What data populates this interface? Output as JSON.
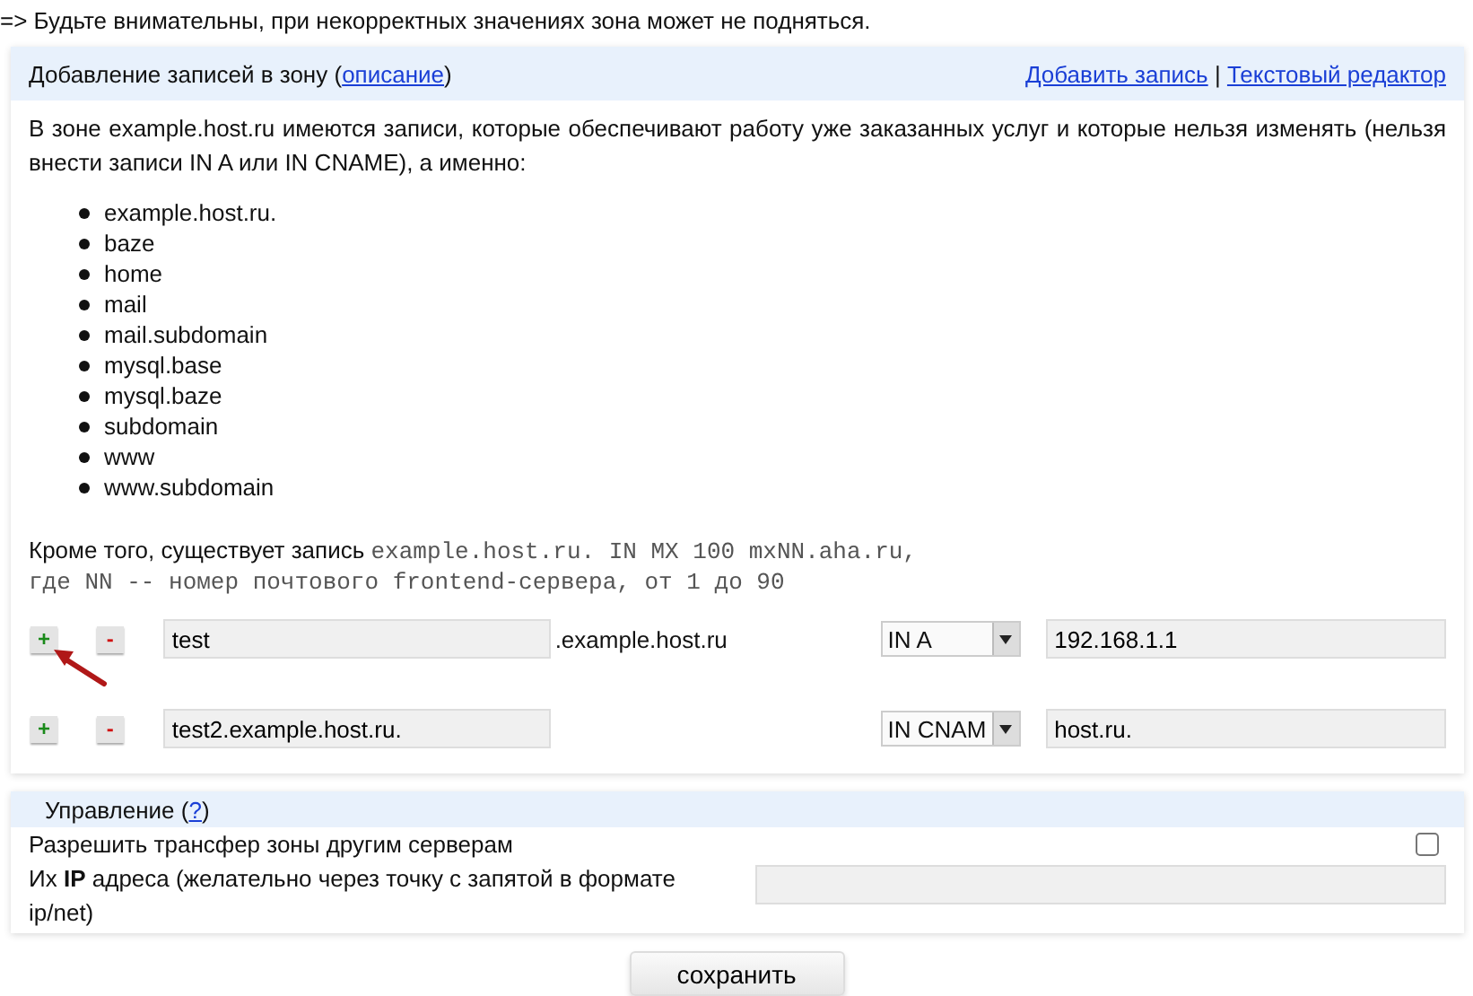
{
  "warning": "=> Будьте внимательны, при некорректных значениях зона может не подняться.",
  "zone_panel": {
    "title": "Добавление записей в зону",
    "title_link": "описание",
    "paren_open": "(",
    "paren_close": ")",
    "separator": "|",
    "actions": [
      "Добавить запись",
      "Текстовый редактор"
    ],
    "description": "В зоне example.host.ru имеются записи, которые обеспечивают работу уже заказанных услуг и которые нельзя изменять (нельзя внести записи IN A или IN CNAME), а именно:",
    "protected_records": [
      "example.host.ru.",
      "baze",
      "home",
      "mail",
      "mail.subdomain",
      "mysql.base",
      "mysql.baze",
      "subdomain",
      "www",
      "www.subdomain"
    ],
    "note_lead": "Кроме того, существует запись",
    "note_code": "example.host.ru. IN MX 100 mxNN.aha.ru,",
    "note_code_2": "где NN -- номер почтового frontend-сервера, от 1 до 90",
    "records": [
      {
        "add": "+",
        "remove": "-",
        "name": "test",
        "suffix": ".example.host.ru",
        "type": "IN A",
        "value": "192.168.1.1",
        "pointer": true
      },
      {
        "add": "+",
        "remove": "-",
        "name": "test2.example.host.ru.",
        "type": "IN CNAM",
        "value": "host.ru.",
        "pointer": false
      }
    ]
  },
  "management_panel": {
    "title": "Управление",
    "help_link": "?",
    "paren_open": "(",
    "paren_close": ")",
    "transfer_label": "Разрешить трансфер зоны другим серверам",
    "transfer_checked": false,
    "ip_label": "Их **IP** адреса (желательно через точку с запятой в формате ip/net)"
  },
  "save_button": "сохранить"
}
